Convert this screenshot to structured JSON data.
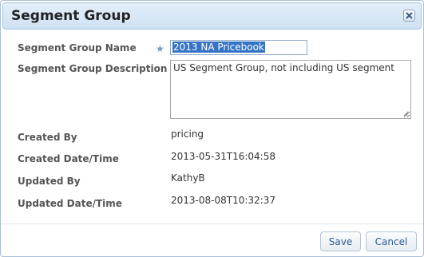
{
  "dialog": {
    "title": "Segment Group"
  },
  "form": {
    "name_label": "Segment Group Name",
    "name_value": "2013 NA Pricebook",
    "description_label": "Segment Group Description",
    "description_value": "US Segment Group, not including US segment",
    "created_by_label": "Created By",
    "created_by_value": "pricing",
    "created_datetime_label": "Created Date/Time",
    "created_datetime_value": "2013-05-31T16:04:58",
    "updated_by_label": "Updated By",
    "updated_by_value": "KathyB",
    "updated_datetime_label": "Updated Date/Time",
    "updated_datetime_value": "2013-08-08T10:32:37"
  },
  "footer": {
    "save_label": "Save",
    "cancel_label": "Cancel"
  },
  "icons": {
    "close": "close-icon",
    "required": "required-star-icon"
  },
  "colors": {
    "titlebar": "#cfe1f3",
    "selection": "#3574c4",
    "button_text": "#2c5d8f"
  }
}
